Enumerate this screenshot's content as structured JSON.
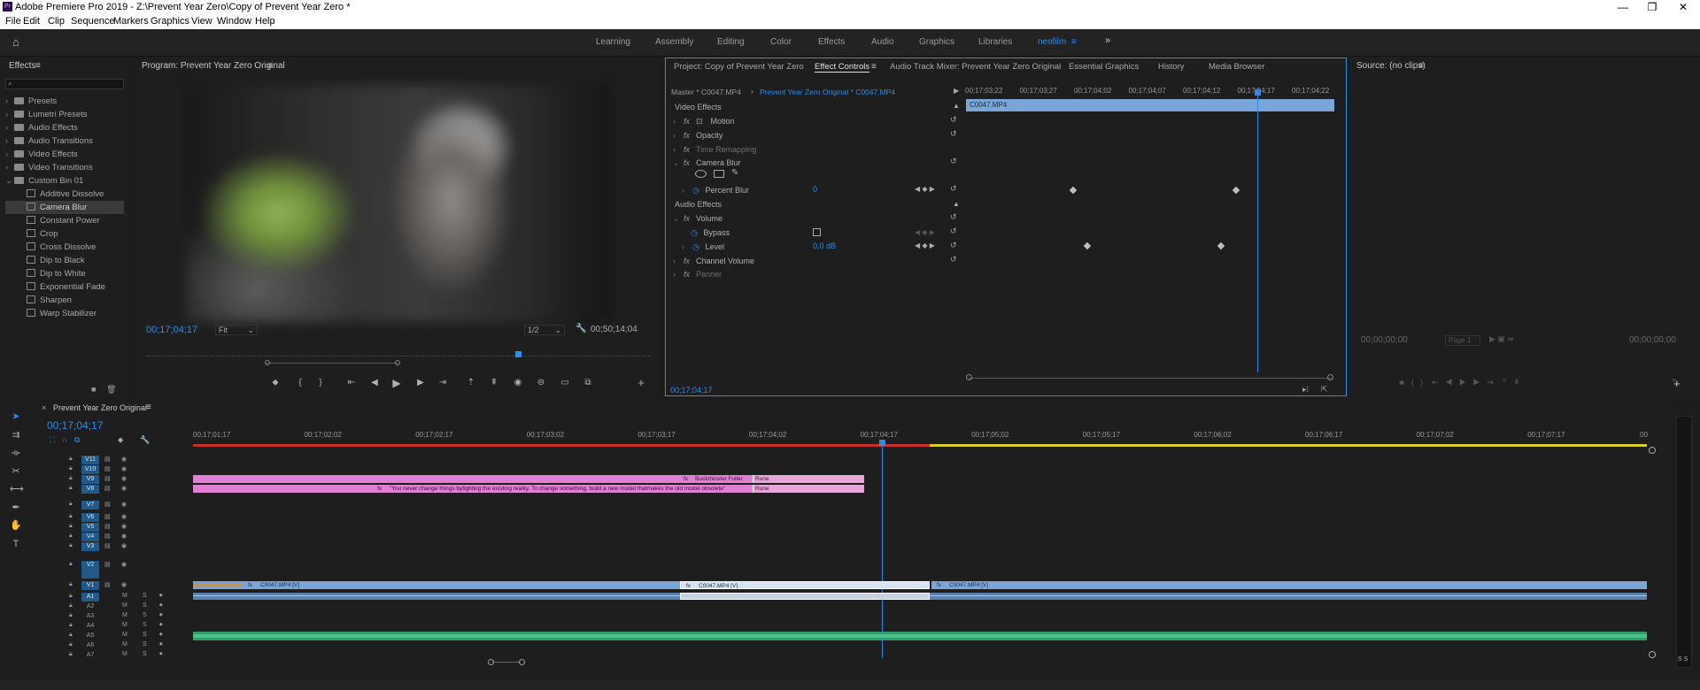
{
  "window": {
    "title": "Adobe Premiere Pro 2019 - Z:\\Prevent Year Zero\\Copy of Prevent Year Zero *",
    "controls": [
      "—",
      "❐",
      "✕"
    ]
  },
  "menu": [
    "File",
    "Edit",
    "Clip",
    "Sequence",
    "Markers",
    "Graphics",
    "View",
    "Window",
    "Help"
  ],
  "workspaces": [
    "Learning",
    "Assembly",
    "Editing",
    "Color",
    "Effects",
    "Audio",
    "Graphics",
    "Libraries",
    "neofilm"
  ],
  "colors": {
    "accent": "#2d8ceb",
    "pink_clip": "#e07fd3",
    "blue_clip": "#7aa5d8",
    "green_audio": "#3cb884",
    "work_red": "#c9302c",
    "work_yellow": "#d8d02a"
  },
  "effects_panel": {
    "title": "Effects",
    "search_placeholder": "",
    "items": [
      {
        "label": "Presets",
        "type": "folder"
      },
      {
        "label": "Lumetri Presets",
        "type": "folder"
      },
      {
        "label": "Audio Effects",
        "type": "folder"
      },
      {
        "label": "Audio Transitions",
        "type": "folder"
      },
      {
        "label": "Video Effects",
        "type": "folder"
      },
      {
        "label": "Video Transitions",
        "type": "folder"
      },
      {
        "label": "Custom Bin 01",
        "type": "folder-open"
      },
      {
        "label": "Additive Dissolve",
        "type": "fx"
      },
      {
        "label": "Camera Blur",
        "type": "fx"
      },
      {
        "label": "Constant Power",
        "type": "fx"
      },
      {
        "label": "Crop",
        "type": "fx"
      },
      {
        "label": "Cross Dissolve",
        "type": "fx"
      },
      {
        "label": "Dip to Black",
        "type": "fx"
      },
      {
        "label": "Dip to White",
        "type": "fx"
      },
      {
        "label": "Exponential Fade",
        "type": "fx"
      },
      {
        "label": "Sharpen",
        "type": "fx"
      },
      {
        "label": "Warp Stabilizer",
        "type": "fx"
      }
    ]
  },
  "program": {
    "title": "Program: Prevent Year Zero Original",
    "timecode": "00;17;04;17",
    "fit": "Fit",
    "resolution": "1/2",
    "duration": "00;50;14;04"
  },
  "effect_controls": {
    "tabs": [
      "Project: Copy of Prevent Year Zero",
      "Effect Controls",
      "Audio Track Mixer: Prevent Year Zero Original",
      "Essential Graphics",
      "History",
      "Media Browser"
    ],
    "master": "Master * C0047.MP4",
    "sequence_clip": "Prevent Year Zero Original * C0047.MP4",
    "clip_bar": "C0047.MP4",
    "ruler": [
      "00;17;03;22",
      "00;17;03;27",
      "00;17;04;02",
      "00;17;04;07",
      "00;17;04;12",
      "00;17;04;17",
      "00;17;04;22"
    ],
    "video_effects_label": "Video Effects",
    "audio_effects_label": "Audio Effects",
    "rows": {
      "motion": "Motion",
      "opacity": "Opacity",
      "time_remapping": "Time Remapping",
      "camera_blur": "Camera Blur",
      "percent_blur": "Percent Blur",
      "percent_blur_value": "0",
      "volume": "Volume",
      "bypass": "Bypass",
      "level": "Level",
      "level_value": "0.0 dB",
      "channel_volume": "Channel Volume",
      "panner": "Panner"
    },
    "timecode": "00;17;04;17"
  },
  "source": {
    "title": "Source: (no clips)",
    "tc_left": "00;00;00;00",
    "page": "Page 1",
    "tc_right": "00;00;00;00"
  },
  "timeline": {
    "title": "Prevent Year Zero Original",
    "timecode": "00;17;04;17",
    "ruler": [
      "00;17;01;17",
      "00;17;02;02",
      "00;17;02;17",
      "00;17;03;02",
      "00;17;03;17",
      "00;17;04;02",
      "00;17;04;17",
      "00;17;05;02",
      "00;17;05;17",
      "00;17;06;02",
      "00;17;06;17",
      "00;17;07;02",
      "00;17;07;17",
      "00"
    ],
    "video_tracks": [
      "V11",
      "V10",
      "V9",
      "V8",
      "V7",
      "V6",
      "V5",
      "V4",
      "V3",
      "V2",
      "V1"
    ],
    "audio_tracks": [
      "A1",
      "A2",
      "A3",
      "A4",
      "A5",
      "A6",
      "A7"
    ],
    "track_toggles": {
      "mute": "M",
      "solo": "S"
    },
    "clips": {
      "buckminster": "Buckminster Fuller",
      "quote": "\"You never change things byfighting the existing reality. To change something, build a new model thatmakes the old model obsolete\"",
      "rune": "Rune",
      "c0047_v": "C0047.MP4 [V]"
    },
    "meter_labels": "S S"
  }
}
